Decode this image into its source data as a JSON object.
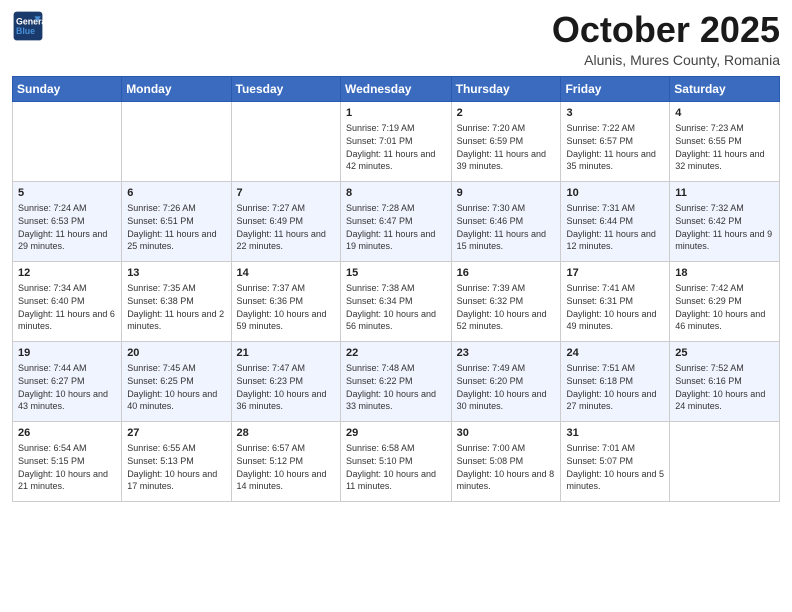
{
  "logo": {
    "line1": "General",
    "line2": "Blue"
  },
  "header": {
    "month": "October 2025",
    "location": "Alunis, Mures County, Romania"
  },
  "days_of_week": [
    "Sunday",
    "Monday",
    "Tuesday",
    "Wednesday",
    "Thursday",
    "Friday",
    "Saturday"
  ],
  "weeks": [
    [
      {
        "day": "",
        "info": ""
      },
      {
        "day": "",
        "info": ""
      },
      {
        "day": "",
        "info": ""
      },
      {
        "day": "1",
        "info": "Sunrise: 7:19 AM\nSunset: 7:01 PM\nDaylight: 11 hours and 42 minutes."
      },
      {
        "day": "2",
        "info": "Sunrise: 7:20 AM\nSunset: 6:59 PM\nDaylight: 11 hours and 39 minutes."
      },
      {
        "day": "3",
        "info": "Sunrise: 7:22 AM\nSunset: 6:57 PM\nDaylight: 11 hours and 35 minutes."
      },
      {
        "day": "4",
        "info": "Sunrise: 7:23 AM\nSunset: 6:55 PM\nDaylight: 11 hours and 32 minutes."
      }
    ],
    [
      {
        "day": "5",
        "info": "Sunrise: 7:24 AM\nSunset: 6:53 PM\nDaylight: 11 hours and 29 minutes."
      },
      {
        "day": "6",
        "info": "Sunrise: 7:26 AM\nSunset: 6:51 PM\nDaylight: 11 hours and 25 minutes."
      },
      {
        "day": "7",
        "info": "Sunrise: 7:27 AM\nSunset: 6:49 PM\nDaylight: 11 hours and 22 minutes."
      },
      {
        "day": "8",
        "info": "Sunrise: 7:28 AM\nSunset: 6:47 PM\nDaylight: 11 hours and 19 minutes."
      },
      {
        "day": "9",
        "info": "Sunrise: 7:30 AM\nSunset: 6:46 PM\nDaylight: 11 hours and 15 minutes."
      },
      {
        "day": "10",
        "info": "Sunrise: 7:31 AM\nSunset: 6:44 PM\nDaylight: 11 hours and 12 minutes."
      },
      {
        "day": "11",
        "info": "Sunrise: 7:32 AM\nSunset: 6:42 PM\nDaylight: 11 hours and 9 minutes."
      }
    ],
    [
      {
        "day": "12",
        "info": "Sunrise: 7:34 AM\nSunset: 6:40 PM\nDaylight: 11 hours and 6 minutes."
      },
      {
        "day": "13",
        "info": "Sunrise: 7:35 AM\nSunset: 6:38 PM\nDaylight: 11 hours and 2 minutes."
      },
      {
        "day": "14",
        "info": "Sunrise: 7:37 AM\nSunset: 6:36 PM\nDaylight: 10 hours and 59 minutes."
      },
      {
        "day": "15",
        "info": "Sunrise: 7:38 AM\nSunset: 6:34 PM\nDaylight: 10 hours and 56 minutes."
      },
      {
        "day": "16",
        "info": "Sunrise: 7:39 AM\nSunset: 6:32 PM\nDaylight: 10 hours and 52 minutes."
      },
      {
        "day": "17",
        "info": "Sunrise: 7:41 AM\nSunset: 6:31 PM\nDaylight: 10 hours and 49 minutes."
      },
      {
        "day": "18",
        "info": "Sunrise: 7:42 AM\nSunset: 6:29 PM\nDaylight: 10 hours and 46 minutes."
      }
    ],
    [
      {
        "day": "19",
        "info": "Sunrise: 7:44 AM\nSunset: 6:27 PM\nDaylight: 10 hours and 43 minutes."
      },
      {
        "day": "20",
        "info": "Sunrise: 7:45 AM\nSunset: 6:25 PM\nDaylight: 10 hours and 40 minutes."
      },
      {
        "day": "21",
        "info": "Sunrise: 7:47 AM\nSunset: 6:23 PM\nDaylight: 10 hours and 36 minutes."
      },
      {
        "day": "22",
        "info": "Sunrise: 7:48 AM\nSunset: 6:22 PM\nDaylight: 10 hours and 33 minutes."
      },
      {
        "day": "23",
        "info": "Sunrise: 7:49 AM\nSunset: 6:20 PM\nDaylight: 10 hours and 30 minutes."
      },
      {
        "day": "24",
        "info": "Sunrise: 7:51 AM\nSunset: 6:18 PM\nDaylight: 10 hours and 27 minutes."
      },
      {
        "day": "25",
        "info": "Sunrise: 7:52 AM\nSunset: 6:16 PM\nDaylight: 10 hours and 24 minutes."
      }
    ],
    [
      {
        "day": "26",
        "info": "Sunrise: 6:54 AM\nSunset: 5:15 PM\nDaylight: 10 hours and 21 minutes."
      },
      {
        "day": "27",
        "info": "Sunrise: 6:55 AM\nSunset: 5:13 PM\nDaylight: 10 hours and 17 minutes."
      },
      {
        "day": "28",
        "info": "Sunrise: 6:57 AM\nSunset: 5:12 PM\nDaylight: 10 hours and 14 minutes."
      },
      {
        "day": "29",
        "info": "Sunrise: 6:58 AM\nSunset: 5:10 PM\nDaylight: 10 hours and 11 minutes."
      },
      {
        "day": "30",
        "info": "Sunrise: 7:00 AM\nSunset: 5:08 PM\nDaylight: 10 hours and 8 minutes."
      },
      {
        "day": "31",
        "info": "Sunrise: 7:01 AM\nSunset: 5:07 PM\nDaylight: 10 hours and 5 minutes."
      },
      {
        "day": "",
        "info": ""
      }
    ]
  ]
}
